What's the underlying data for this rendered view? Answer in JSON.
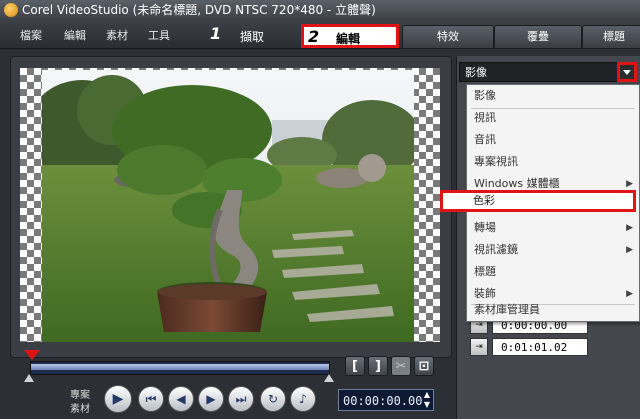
{
  "window": {
    "title": "Corel VideoStudio (未命名標題, DVD NTSC 720*480 - 立體聲)"
  },
  "menu": {
    "items": [
      "檔案",
      "編輯",
      "素材",
      "工具"
    ]
  },
  "steps": [
    {
      "number": "1",
      "label": "擷取"
    },
    {
      "number": "2",
      "label": "編輯"
    },
    {
      "label": "特效"
    },
    {
      "label": "覆疊"
    },
    {
      "label": "標題"
    }
  ],
  "library": {
    "selected": "影像",
    "menu": [
      {
        "label": "影像",
        "submenu": false
      },
      {
        "label": "視訊",
        "submenu": false
      },
      {
        "label": "音訊",
        "submenu": false
      },
      {
        "label": "專案視訊",
        "submenu": false
      },
      {
        "label": "Windows 媒體櫃",
        "submenu": true
      },
      {
        "label": "色彩",
        "submenu": false
      },
      {
        "label": "轉場",
        "submenu": true
      },
      {
        "label": "視訊濾鏡",
        "submenu": true
      },
      {
        "label": "標題",
        "submenu": false
      },
      {
        "label": "裝飾",
        "submenu": true
      },
      {
        "label": "素材庫管理員",
        "submenu": false
      }
    ],
    "highlighted_index": 5
  },
  "player": {
    "mode_project": "專案",
    "mode_clip": "素材",
    "timecode": "00:00:00.00",
    "trim_start_icon": "[",
    "trim_end_icon": "]"
  },
  "properties": {
    "duration_1": "0:00:00.00",
    "duration_2": "0:01:01.02"
  },
  "icons": {
    "submenu_arrow": "▶",
    "combo": "chevron-down-icon"
  },
  "colors": {
    "highlight": "#e01414",
    "timecode_bg": "#0e1a33"
  }
}
